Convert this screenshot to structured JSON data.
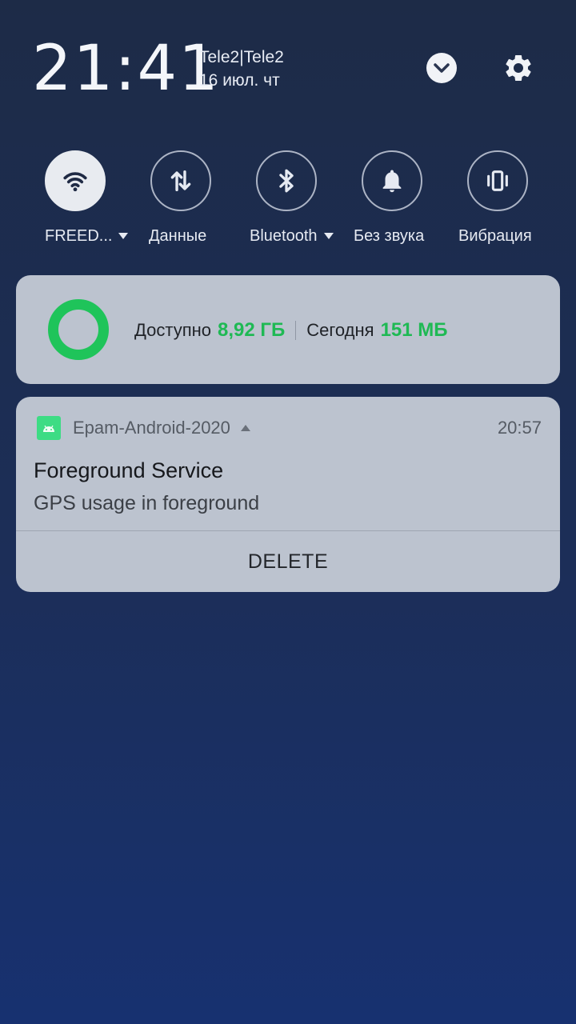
{
  "status": {
    "time": "21:41",
    "carrier": "Tele2|Tele2",
    "date": "16 июл. чт"
  },
  "header": {
    "expand_icon": "chevron-down-icon",
    "settings_icon": "gear-icon"
  },
  "quick_tiles": [
    {
      "label": "FREED...",
      "icon": "wifi-icon",
      "active": true,
      "has_dropdown": true
    },
    {
      "label": "Данные",
      "icon": "mobile-data-icon",
      "active": false,
      "has_dropdown": false
    },
    {
      "label": "Bluetooth",
      "icon": "bluetooth-icon",
      "active": false,
      "has_dropdown": true
    },
    {
      "label": "Без звука",
      "icon": "bell-icon",
      "active": false,
      "has_dropdown": false
    },
    {
      "label": "Вибрация",
      "icon": "vibration-icon",
      "active": false,
      "has_dropdown": false
    }
  ],
  "data_usage": {
    "available_label": "Доступно",
    "available_value": "8,92 ГБ",
    "today_label": "Сегодня",
    "today_value": "151 МБ",
    "accent_color": "#1fc45a"
  },
  "notification": {
    "app_name": "Epam-Android-2020",
    "time": "20:57",
    "title": "Foreground Service",
    "text": "GPS usage in foreground",
    "action_label": "DELETE",
    "app_icon": "android-icon"
  }
}
